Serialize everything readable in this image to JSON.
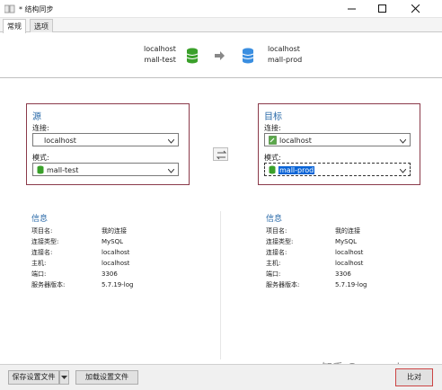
{
  "window": {
    "title": "* 结构同步"
  },
  "tabs": [
    {
      "label": "常规"
    },
    {
      "label": "选项"
    }
  ],
  "summary": {
    "source_host": "localhost",
    "source_schema": "mall-test",
    "target_host": "localhost",
    "target_schema": "mall-prod",
    "arrow_icon": "right-arrow-icon"
  },
  "source": {
    "title": "源",
    "connection_label": "连接:",
    "connection_value": "localhost",
    "schema_label": "模式:",
    "schema_value": "mall-test"
  },
  "target": {
    "title": "目标",
    "connection_label": "连接:",
    "connection_value": "localhost",
    "schema_label": "模式:",
    "schema_value": "mall-prod"
  },
  "source_info": {
    "title": "信息",
    "rows": [
      {
        "k": "项目名:",
        "v": "我的连接"
      },
      {
        "k": "连接类型:",
        "v": "MySQL"
      },
      {
        "k": "连接名:",
        "v": "localhost"
      },
      {
        "k": "主机:",
        "v": "localhost"
      },
      {
        "k": "端口:",
        "v": "3306"
      },
      {
        "k": "服务器版本:",
        "v": "5.7.19-log"
      }
    ]
  },
  "target_info": {
    "title": "信息",
    "rows": [
      {
        "k": "项目名:",
        "v": "我的连接"
      },
      {
        "k": "连接类型:",
        "v": "MySQL"
      },
      {
        "k": "连接名:",
        "v": "localhost"
      },
      {
        "k": "主机:",
        "v": "localhost"
      },
      {
        "k": "端口:",
        "v": "3306"
      },
      {
        "k": "服务器版本:",
        "v": "5.7.19-log"
      }
    ]
  },
  "footer": {
    "save_label": "保存设置文件",
    "load_label": "加载设置文件",
    "next_label": "比对"
  },
  "watermark": "知乎 @macrozheng",
  "colors": {
    "accent": "#2a6aa8",
    "group_border": "#8b3a4a",
    "db_green": "#3aa02a",
    "db_blue": "#3a8ee0",
    "selection": "#0a64d6"
  }
}
